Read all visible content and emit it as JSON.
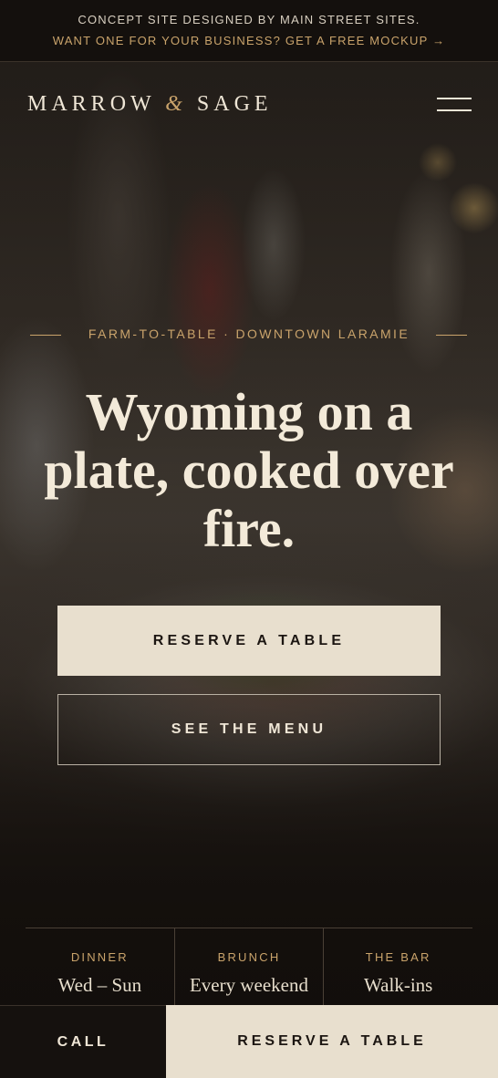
{
  "promo": {
    "line1": "CONCEPT SITE DESIGNED BY MAIN STREET SITES.",
    "line2": "WANT ONE FOR YOUR BUSINESS? GET A FREE MOCKUP →"
  },
  "header": {
    "logo_left": "MARROW",
    "logo_amp": "&",
    "logo_right": "SAGE",
    "menu_icon": "hamburger-icon"
  },
  "hero": {
    "eyebrow": "FARM-TO-TABLE · DOWNTOWN LARAMIE",
    "headline": "Wyoming on a plate, cooked over fire.",
    "reserve_label": "RESERVE A TABLE",
    "menu_label": "SEE THE MENU"
  },
  "info": [
    {
      "label": "DINNER",
      "value": "Wed – Sun"
    },
    {
      "label": "BRUNCH",
      "value": "Every weekend"
    },
    {
      "label": "THE BAR",
      "value": "Walk-ins"
    }
  ],
  "bottom_bar": {
    "call_label": "CALL",
    "reserve_label": "RESERVE A TABLE"
  },
  "colors": {
    "accent": "#c9a36b",
    "cream": "#e8dfce",
    "dark": "#120e0b"
  }
}
